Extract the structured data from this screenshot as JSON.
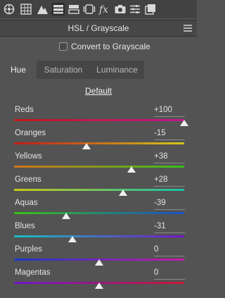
{
  "toolbar": {
    "icons": [
      "basic-icon",
      "tone-curve-icon",
      "detail-icon",
      "hsl-icon",
      "split-toning-icon",
      "lens-icon",
      "fx-icon",
      "camera-icon",
      "presets-icon",
      "snapshots-icon"
    ],
    "active": "hsl-icon"
  },
  "panel": {
    "title": "HSL / Grayscale"
  },
  "grayscale": {
    "label": "Convert to Grayscale",
    "checked": false
  },
  "tabs": [
    {
      "label": "Hue",
      "active": true
    },
    {
      "label": "Saturation",
      "active": false
    },
    {
      "label": "Luminance",
      "active": false
    }
  ],
  "default_label": "Default",
  "sliders": [
    {
      "label": "Reds",
      "value": "+100",
      "amount": 100,
      "colors": [
        "#c01818",
        "#c0168c"
      ]
    },
    {
      "label": "Oranges",
      "value": "-15",
      "amount": -15,
      "colors": [
        "#c41818",
        "#d0c818"
      ]
    },
    {
      "label": "Yellows",
      "value": "+38",
      "amount": 38,
      "colors": [
        "#d07418",
        "#38c018"
      ]
    },
    {
      "label": "Greens",
      "value": "+28",
      "amount": 28,
      "colors": [
        "#c8c818",
        "#18c0a8"
      ]
    },
    {
      "label": "Aquas",
      "value": "-39",
      "amount": -39,
      "colors": [
        "#38c018",
        "#1850c8"
      ]
    },
    {
      "label": "Blues",
      "value": "-31",
      "amount": -31,
      "colors": [
        "#18c0c0",
        "#7418c8"
      ]
    },
    {
      "label": "Purples",
      "value": "0",
      "amount": 0,
      "colors": [
        "#1838c8",
        "#c818a8"
      ]
    },
    {
      "label": "Magentas",
      "value": "0",
      "amount": 0,
      "colors": [
        "#7018c8",
        "#c81838"
      ]
    }
  ]
}
